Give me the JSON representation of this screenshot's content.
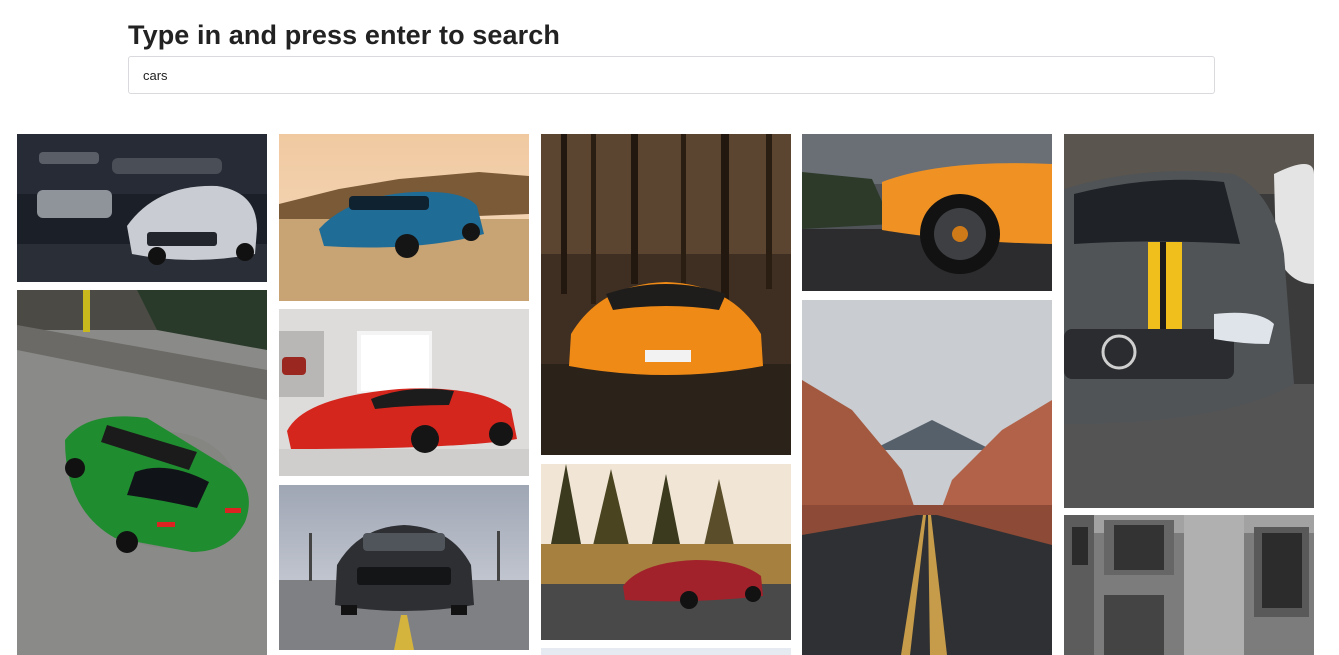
{
  "header": {
    "title": "Type in and press enter to search"
  },
  "search": {
    "value": "cars",
    "placeholder": ""
  },
  "gallery": {
    "photos": [
      {
        "subject": "white-camaro-in-garage"
      },
      {
        "subject": "green-mustang-top-view"
      },
      {
        "subject": "blue-camaro-desert"
      },
      {
        "subject": "red-ferrari-laferrari"
      },
      {
        "subject": "black-mustang-front"
      },
      {
        "subject": "orange-lamborghini-forest"
      },
      {
        "subject": "red-mercedes-amg-gt-road"
      },
      {
        "subject": "orange-lamborghini-rear-wheel"
      },
      {
        "subject": "desert-canyon-road"
      },
      {
        "subject": "grey-mercedes-yellow-stripe"
      },
      {
        "subject": "building-facade-bw"
      },
      {
        "subject": "light-blue-partial"
      }
    ]
  }
}
